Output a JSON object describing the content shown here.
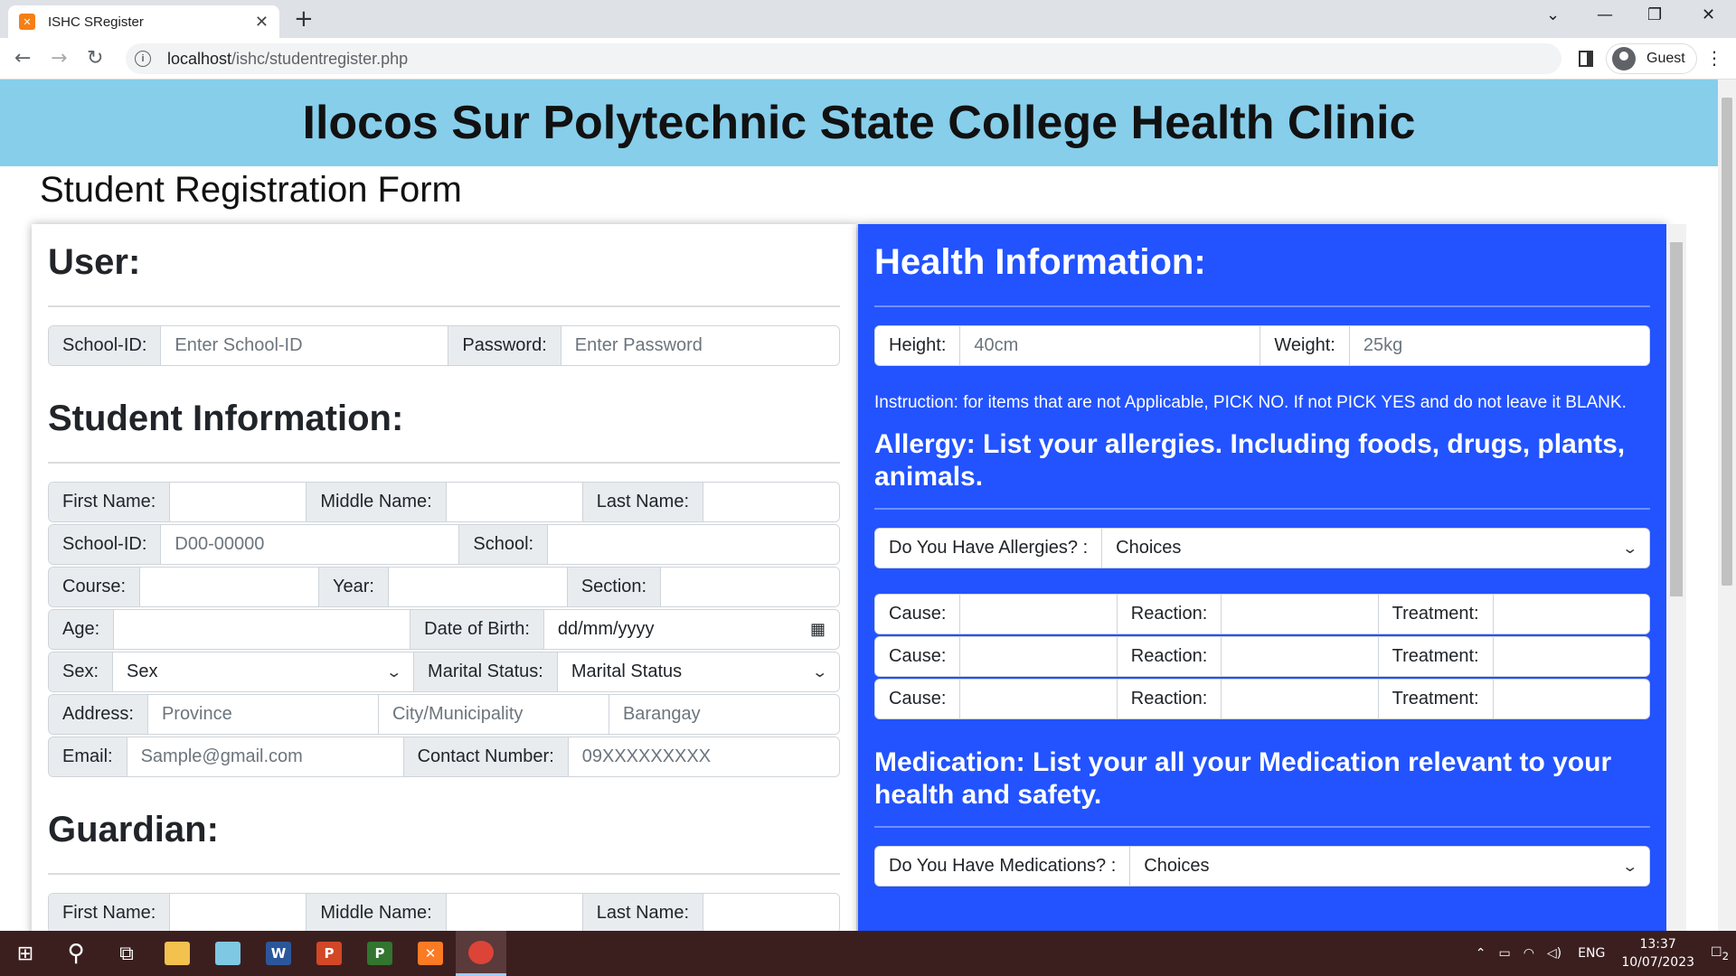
{
  "browser": {
    "tab_title": "ISHC SRegister",
    "favicon": "xampp-icon",
    "new_tab": "+",
    "url_host": "localhost",
    "url_path": "/ishc/studentregister.php",
    "profile": "Guest",
    "window_controls": [
      "⌄",
      "—",
      "❐",
      "✕"
    ]
  },
  "header": {
    "banner_title": "Ilocos Sur Polytechnic State College Health Clinic",
    "form_title": "Student Registration Form"
  },
  "user": {
    "heading": "User:",
    "school_id_label": "School-ID:",
    "school_id_placeholder": "Enter School-ID",
    "password_label": "Password:",
    "password_placeholder": "Enter Password"
  },
  "student": {
    "heading": "Student Information:",
    "first_name_label": "First Name:",
    "middle_name_label": "Middle Name:",
    "last_name_label": "Last Name:",
    "school_id_label": "School-ID:",
    "school_id_placeholder": "D00-00000",
    "school_label": "School:",
    "course_label": "Course:",
    "year_label": "Year:",
    "section_label": "Section:",
    "age_label": "Age:",
    "dob_label": "Date of Birth:",
    "dob_placeholder": "dd/mm/yyyy",
    "sex_label": "Sex:",
    "sex_value": "Sex",
    "marital_label": "Marital Status:",
    "marital_value": "Marital Status",
    "address_label": "Address:",
    "province_placeholder": "Province",
    "city_placeholder": "City/Municipality",
    "barangay_placeholder": "Barangay",
    "email_label": "Email:",
    "email_placeholder": "Sample@gmail.com",
    "contact_label": "Contact Number:",
    "contact_placeholder": "09XXXXXXXXX"
  },
  "guardian": {
    "heading": "Guardian:",
    "first_name_label": "First Name:",
    "middle_name_label": "Middle Name:",
    "last_name_label": "Last Name:"
  },
  "health": {
    "heading": "Health Information:",
    "height_label": "Height:",
    "height_placeholder": "40cm",
    "weight_label": "Weight:",
    "weight_placeholder": "25kg",
    "instruction": "Instruction: for items that are not Applicable, PICK NO. If not PICK YES and do not leave it BLANK.",
    "allergy_heading": "Allergy: List your allergies. Including foods, drugs, plants, animals.",
    "allergy_question": "Do You Have Allergies? :",
    "allergy_choice": "Choices",
    "cause_label": "Cause:",
    "reaction_label": "Reaction:",
    "treatment_label": "Treatment:",
    "medication_heading": "Medication: List your all your Medication relevant to your health and safety.",
    "medication_question": "Do You Have Medications? :",
    "medication_choice": "Choices",
    "accent_color": "#2253ff",
    "banner_color": "#87ceeb"
  },
  "taskbar": {
    "lang": "ENG",
    "time": "13:37",
    "date": "10/07/2023",
    "notifications": "2"
  }
}
